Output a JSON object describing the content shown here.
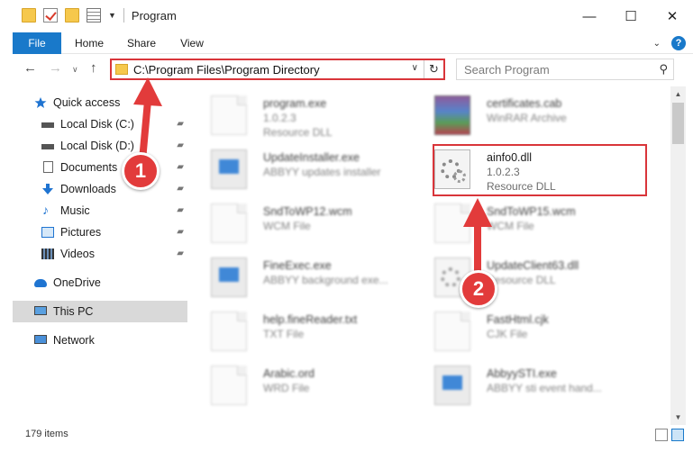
{
  "window": {
    "title": "Program",
    "controls": {
      "minimize": "—",
      "maximize": "☐",
      "close": "✕"
    }
  },
  "ribbon": {
    "tabs": [
      "File",
      "Home",
      "Share",
      "View"
    ],
    "collapse": "⌄",
    "help": "?"
  },
  "nav": {
    "back": "←",
    "forward": "→",
    "recent": "∨",
    "up": "↑",
    "address": "C:\\Program Files\\Program Directory",
    "refresh": "↻",
    "search_placeholder": "Search Program",
    "search_icon": "⚲"
  },
  "sidebar": {
    "items": [
      {
        "label": "Quick access",
        "icon": "star-icon",
        "pinned": false
      },
      {
        "label": "Local Disk (C:)",
        "icon": "drive-icon",
        "pinned": true
      },
      {
        "label": "Local Disk (D:)",
        "icon": "drive-icon",
        "pinned": true
      },
      {
        "label": "Documents",
        "icon": "documents-icon",
        "pinned": true
      },
      {
        "label": "Downloads",
        "icon": "download-icon",
        "pinned": true
      },
      {
        "label": "Music",
        "icon": "music-icon",
        "pinned": true
      },
      {
        "label": "Pictures",
        "icon": "pictures-icon",
        "pinned": true
      },
      {
        "label": "Videos",
        "icon": "videos-icon",
        "pinned": true
      },
      {
        "label": "OneDrive",
        "icon": "cloud-icon",
        "pinned": false
      },
      {
        "label": "This PC",
        "icon": "computer-icon",
        "pinned": false,
        "selected": true
      },
      {
        "label": "Network",
        "icon": "network-icon",
        "pinned": false
      }
    ],
    "pin_glyph": "📌"
  },
  "files": [
    {
      "name": "program.exe",
      "line1": "1.0.2.3",
      "line2": "Resource DLL",
      "icon": "doc-icon"
    },
    {
      "name": "certificates.cab",
      "line1": "WinRAR Archive",
      "line2": "",
      "icon": "archive-icon"
    },
    {
      "name": "UpdateInstaller.exe",
      "line1": "ABBYY updates installer",
      "line2": "",
      "icon": "app-icon"
    },
    {
      "name": "ainfo0.dll",
      "line1": "1.0.2.3",
      "line2": "Resource DLL",
      "icon": "dll-gear-icon"
    },
    {
      "name": "SndToWP12.wcm",
      "line1": "WCM File",
      "line2": "",
      "icon": "doc-icon"
    },
    {
      "name": "SndToWP15.wcm",
      "line1": "WCM File",
      "line2": "",
      "icon": "doc-icon"
    },
    {
      "name": "FineExec.exe",
      "line1": "ABBYY background exe...",
      "line2": "",
      "icon": "app-icon"
    },
    {
      "name": "UpdateClient63.dll",
      "line1": "Resource DLL",
      "line2": "",
      "icon": "dll-gear-icon"
    },
    {
      "name": "help.fineReader.txt",
      "line1": "TXT File",
      "line2": "",
      "icon": "doc-icon"
    },
    {
      "name": "FastHtml.cjk",
      "line1": "CJK File",
      "line2": "",
      "icon": "doc-icon"
    },
    {
      "name": "Arabic.ord",
      "line1": "WRD File",
      "line2": "",
      "icon": "doc-icon"
    },
    {
      "name": "AbbyySTI.exe",
      "line1": "ABBYY sti event hand...",
      "line2": "",
      "icon": "app-icon"
    }
  ],
  "status": {
    "item_count": "179 items"
  },
  "annotations": {
    "step1": "1",
    "step2": "2",
    "accent": "#e23b3b"
  }
}
